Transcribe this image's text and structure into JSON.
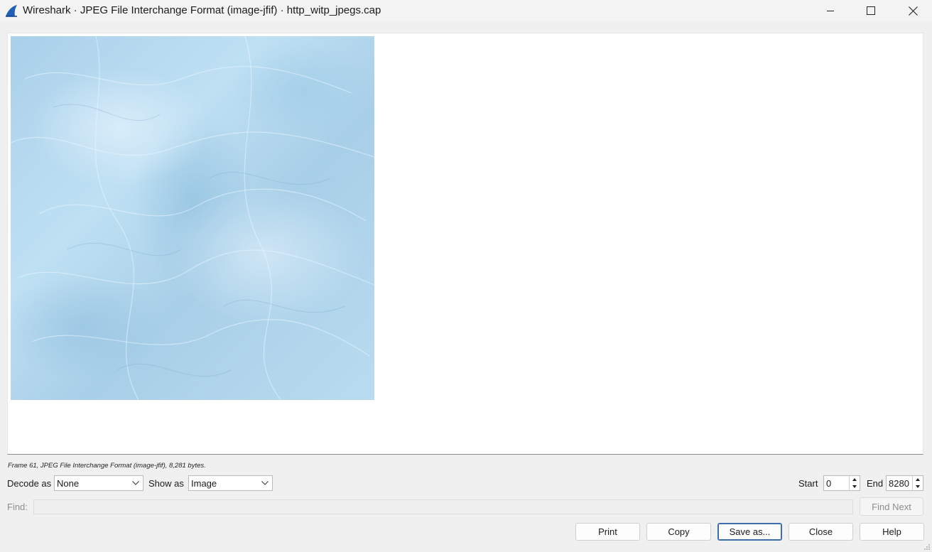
{
  "window": {
    "title": "Wireshark · JPEG File Interchange Format (image-jfif) · http_witp_jpegs.cap",
    "app_icon": "wireshark-fin-icon",
    "controls": [
      "minimize-icon",
      "maximize-icon",
      "close-icon"
    ]
  },
  "viewer": {
    "image_description_icon": "jpeg-image",
    "status": "Frame 61, JPEG File Interchange Format (image-jfif), 8,281 bytes."
  },
  "controls": {
    "decode_as_label": "Decode as",
    "decode_as_value": "None",
    "show_as_label": "Show as",
    "show_as_value": "Image",
    "start_label": "Start",
    "start_value": "0",
    "end_label": "End",
    "end_value": "8280"
  },
  "find": {
    "label": "Find:",
    "value": "",
    "find_next_label": "Find Next"
  },
  "buttons": {
    "print": "Print",
    "copy": "Copy",
    "save_as": "Save as...",
    "close": "Close",
    "help": "Help"
  },
  "colors": {
    "image_base": "#a9d0ea",
    "default_button_border": "#3a6fb0",
    "wireshark_blue": "#1f5fb8"
  }
}
